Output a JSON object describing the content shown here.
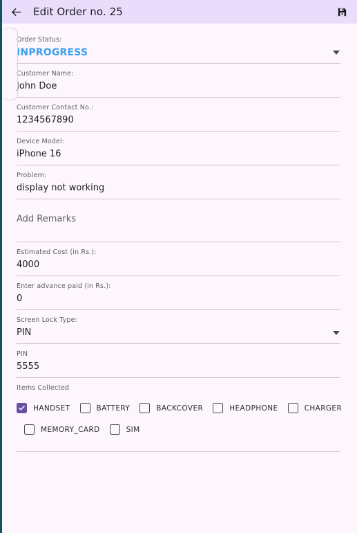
{
  "app_bar": {
    "back_icon": "arrow-left-icon",
    "title": "Edit Order no. 25",
    "save_icon": "save-floppy-icon"
  },
  "theme": {
    "app_bar_bg": "#e9ddfb",
    "page_bg": "#fdf6fd",
    "status_color": "#3fa0ee",
    "checkbox_checked_color": "#6750a4",
    "underline_color": "#cfc4cd",
    "edge_strip_color": "#0d5661"
  },
  "form": {
    "order_status": {
      "label": "Order Status:",
      "value": "INPROGRESS",
      "type": "dropdown"
    },
    "customer_name": {
      "label": "Customer Name:",
      "value": "John Doe"
    },
    "customer_contact": {
      "label": "Customer Contact No.:",
      "value": "1234567890"
    },
    "device_model": {
      "label": "Device Model:",
      "value": "iPhone 16"
    },
    "problem": {
      "label": "Problem:",
      "value": "display not working"
    },
    "remarks": {
      "placeholder": "Add Remarks",
      "value": ""
    },
    "estimated_cost": {
      "label": "Estimated Cost (in Rs.):",
      "value": "4000"
    },
    "advance_paid": {
      "label": "Enter advance paid (in Rs.):",
      "value": "0"
    },
    "screen_lock_type": {
      "label": "Screen Lock Type:",
      "value": "PIN",
      "type": "dropdown"
    },
    "pin": {
      "label": "PIN",
      "value": "5555"
    }
  },
  "items_collected": {
    "label": "Items Collected",
    "row1": [
      {
        "label": "HANDSET",
        "checked": true
      },
      {
        "label": "BATTERY",
        "checked": false
      },
      {
        "label": "BACKCOVER",
        "checked": false
      },
      {
        "label": "HEADPHONE",
        "checked": false
      },
      {
        "label": "CHARGER",
        "checked": false
      }
    ],
    "row2": [
      {
        "label": "MEMORY_CARD",
        "checked": false
      },
      {
        "label": "SIM",
        "checked": false
      }
    ]
  }
}
